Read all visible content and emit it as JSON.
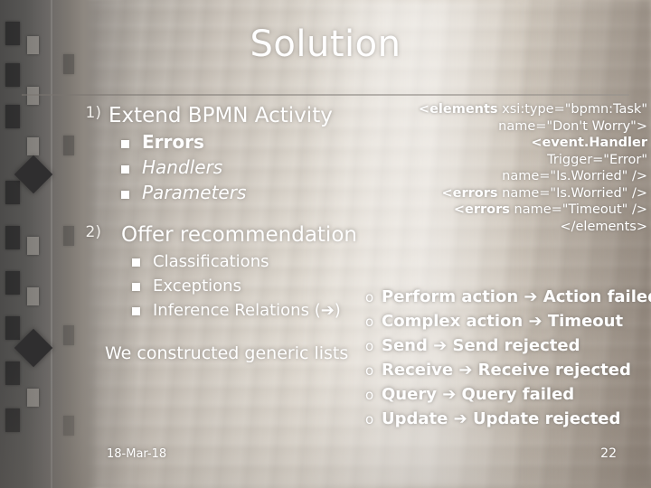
{
  "slide": {
    "title": "Solution",
    "footer_date": "18-Mar-18",
    "page_number": "22"
  },
  "left_column": {
    "items": [
      {
        "number": "1)",
        "heading": "Extend BPMN Activity",
        "sub_items": [
          "Errors",
          "Handlers",
          "Parameters"
        ]
      },
      {
        "number": "2)",
        "heading": "Offer recommendation",
        "sub_items": [
          "Classifications",
          "Exceptions",
          "Inference Relations (➔)"
        ]
      }
    ],
    "closing_text": "We constructed generic lists"
  },
  "code_block": {
    "lines": [
      {
        "tag": "<elements",
        "rest": " xsi:type=\"bpmn:Task\""
      },
      {
        "tag": "",
        "rest": "name=\"Don't Worry\">"
      },
      {
        "tag": "<event.Handler",
        "rest": ""
      },
      {
        "tag": "",
        "rest": "Trigger=\"Error\""
      },
      {
        "tag": "",
        "rest": "name=\"Is.Worried\" />"
      },
      {
        "tag": "<errors",
        "rest": " name=\"Is.Worried\" />"
      },
      {
        "tag": "<errors",
        "rest": " name=\"Timeout\"  />"
      },
      {
        "tag": "",
        "rest": "</elements>"
      }
    ]
  },
  "arrow_list": {
    "bullet": "o",
    "items": [
      "Perform action ➔ Action failed",
      "Complex action ➔ Timeout",
      "Send ➔ Send rejected",
      "Receive ➔ Receive rejected",
      "Query ➔ Query failed",
      "Update ➔ Update rejected"
    ]
  },
  "colors": {
    "text": "#ffffff",
    "rule": "#8d8883"
  }
}
